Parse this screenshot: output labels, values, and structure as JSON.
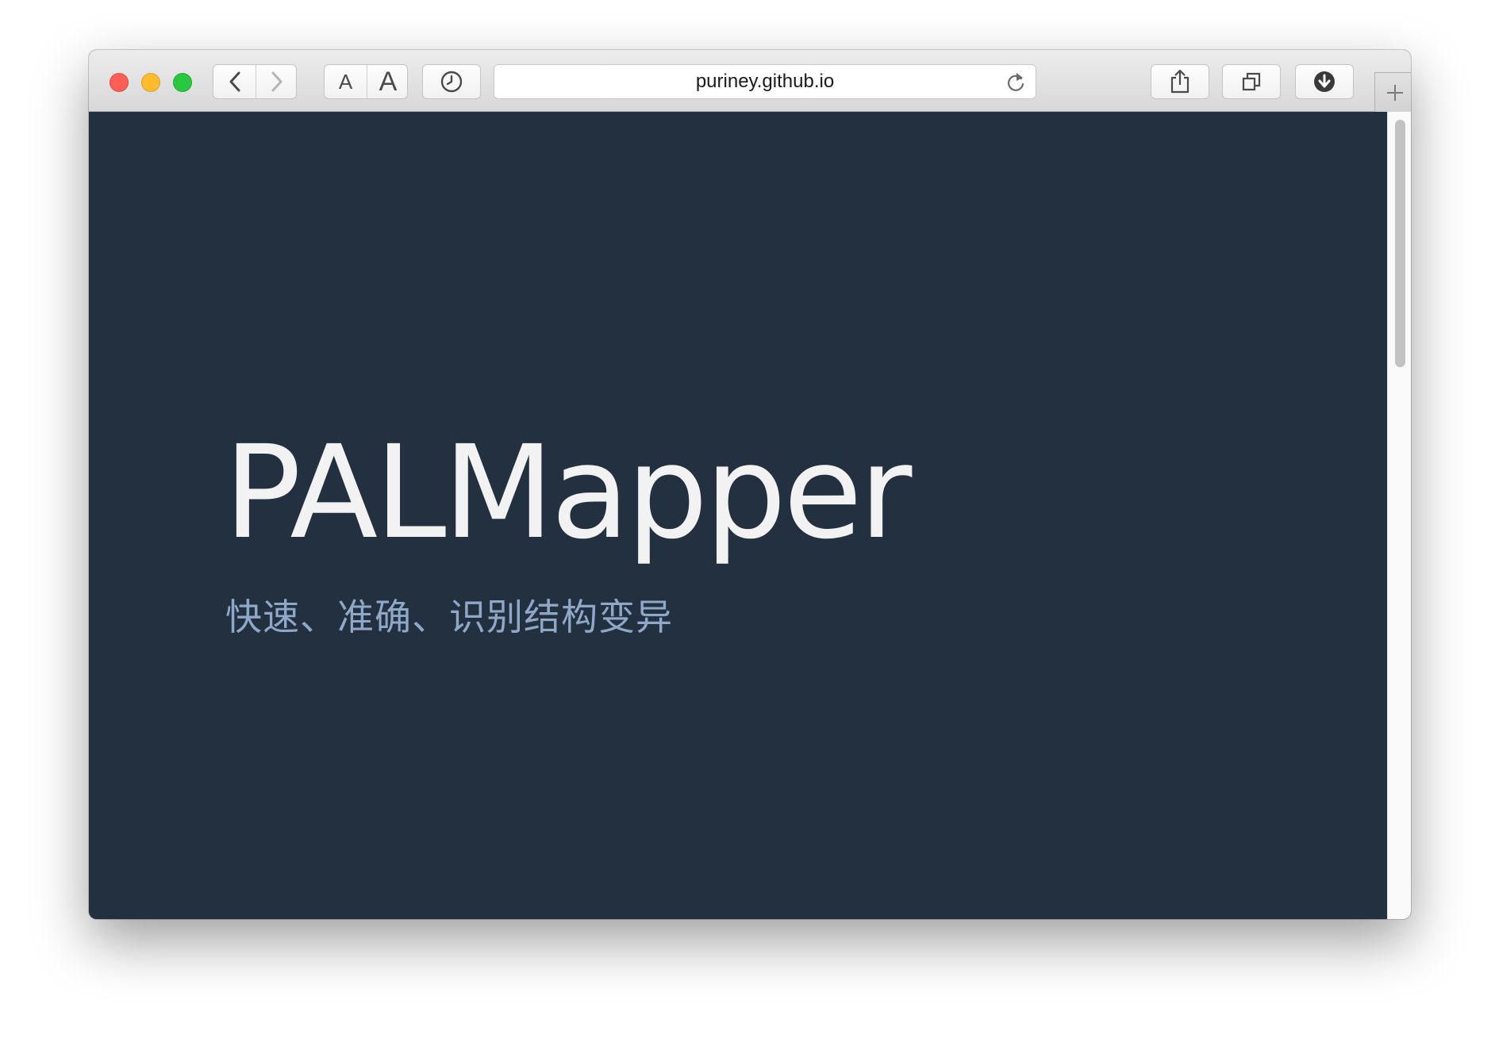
{
  "browser": {
    "address": "puriney.github.io",
    "font_small_label": "A",
    "font_large_label": "A",
    "icons": {
      "close": "close-traffic-light",
      "minimize": "minimize-traffic-light",
      "maximize": "maximize-traffic-light",
      "back": "chevron-left-icon",
      "forward": "chevron-right-icon",
      "history": "clock-icon",
      "reload": "reload-icon",
      "share": "share-icon",
      "tabs": "tabs-overview-icon",
      "downloads": "download-icon",
      "new_tab": "plus-icon"
    },
    "colors": {
      "close": "#fc5f57",
      "minimize": "#fdbc2e",
      "maximize": "#28c840"
    }
  },
  "page": {
    "title": "PALMapper",
    "subtitle": "快速、准确、识别结构变异",
    "colors": {
      "background": "#23303f",
      "title": "#f2f2f2",
      "subtitle": "#8fa8c8"
    }
  }
}
